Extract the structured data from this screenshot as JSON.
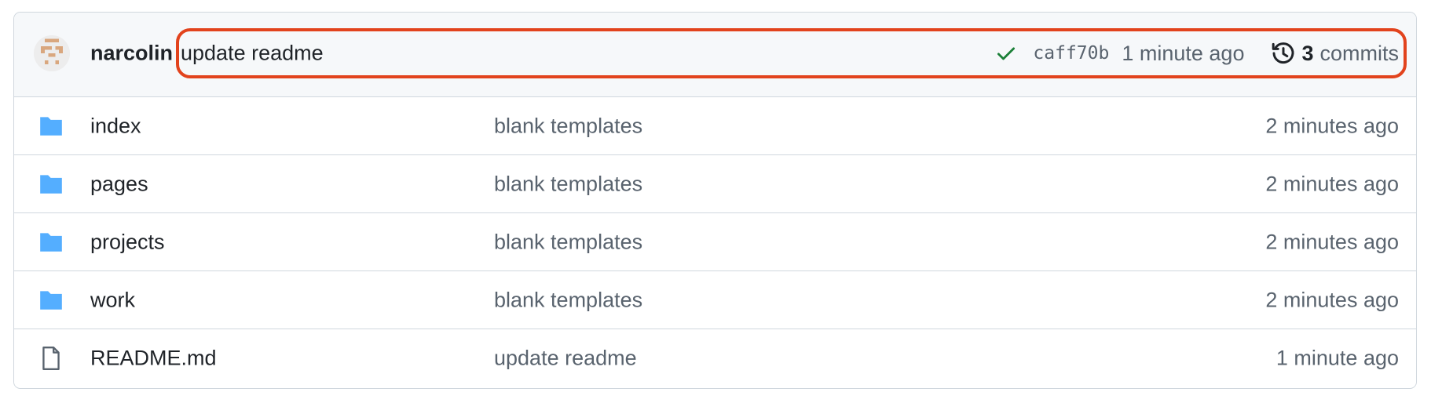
{
  "latest_commit": {
    "author": "narcolin",
    "message": "update readme",
    "sha": "caff70b",
    "time": "1 minute ago",
    "status": "success",
    "status_icon": "check-icon",
    "history_icon": "history-icon",
    "commits_count": "3",
    "commits_label": "commits",
    "highlight_color": "#e2431d"
  },
  "files": [
    {
      "name": "index",
      "type": "folder",
      "icon": "folder-icon",
      "message": "blank templates",
      "time": "2 minutes ago"
    },
    {
      "name": "pages",
      "type": "folder",
      "icon": "folder-icon",
      "message": "blank templates",
      "time": "2 minutes ago"
    },
    {
      "name": "projects",
      "type": "folder",
      "icon": "folder-icon",
      "message": "blank templates",
      "time": "2 minutes ago"
    },
    {
      "name": "work",
      "type": "folder",
      "icon": "folder-icon",
      "message": "blank templates",
      "time": "2 minutes ago"
    },
    {
      "name": "README.md",
      "type": "file",
      "icon": "file-icon",
      "message": "update readme",
      "time": "1 minute ago"
    }
  ],
  "colors": {
    "folder": "#54aeff",
    "check": "#1a7f37",
    "text": "#1f2328",
    "muted": "#59636e",
    "border": "#d0d7de",
    "header_bg": "#f6f8fa"
  }
}
